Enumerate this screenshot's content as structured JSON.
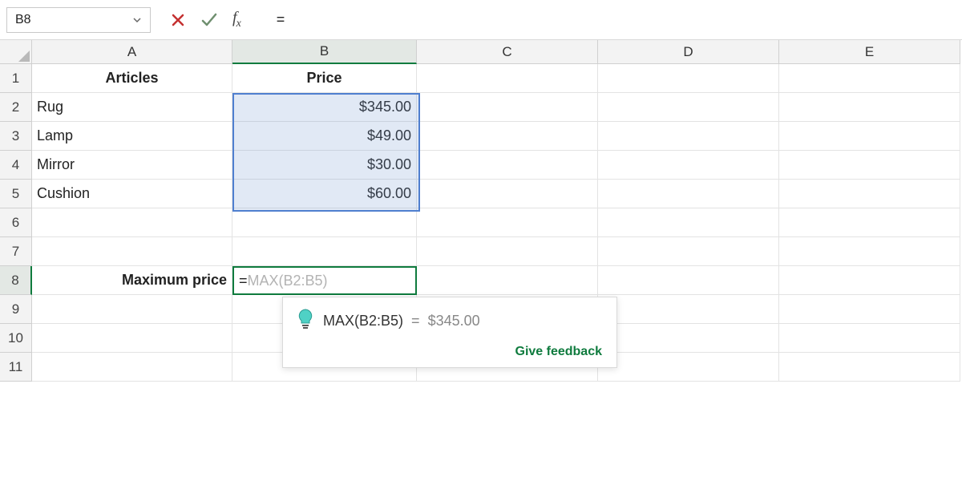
{
  "formula_bar": {
    "name_box": "B8",
    "formula_input": "="
  },
  "columns": [
    "A",
    "B",
    "C",
    "D",
    "E"
  ],
  "rows": [
    "1",
    "2",
    "3",
    "4",
    "5",
    "6",
    "7",
    "8",
    "9",
    "10",
    "11"
  ],
  "headers": {
    "A1": "Articles",
    "B1": "Price"
  },
  "data": {
    "A2": "Rug",
    "B2": "$345.00",
    "A3": "Lamp",
    "B3": "$49.00",
    "A4": "Mirror",
    "B4": "$30.00",
    "A5": "Cushion",
    "B5": "$60.00",
    "A8": "Maximum price"
  },
  "active_cell": {
    "ref": "B8",
    "typed": "=",
    "suggestion_ghost": "MAX(B2:B5)"
  },
  "range_selection": {
    "ref": "B2:B5"
  },
  "tooltip": {
    "formula": "MAX(B2:B5)",
    "equals": "=",
    "result": "$345.00",
    "feedback": "Give feedback"
  },
  "colors": {
    "accent_green": "#0f7b3e",
    "range_blue": "#4f7fcf"
  }
}
